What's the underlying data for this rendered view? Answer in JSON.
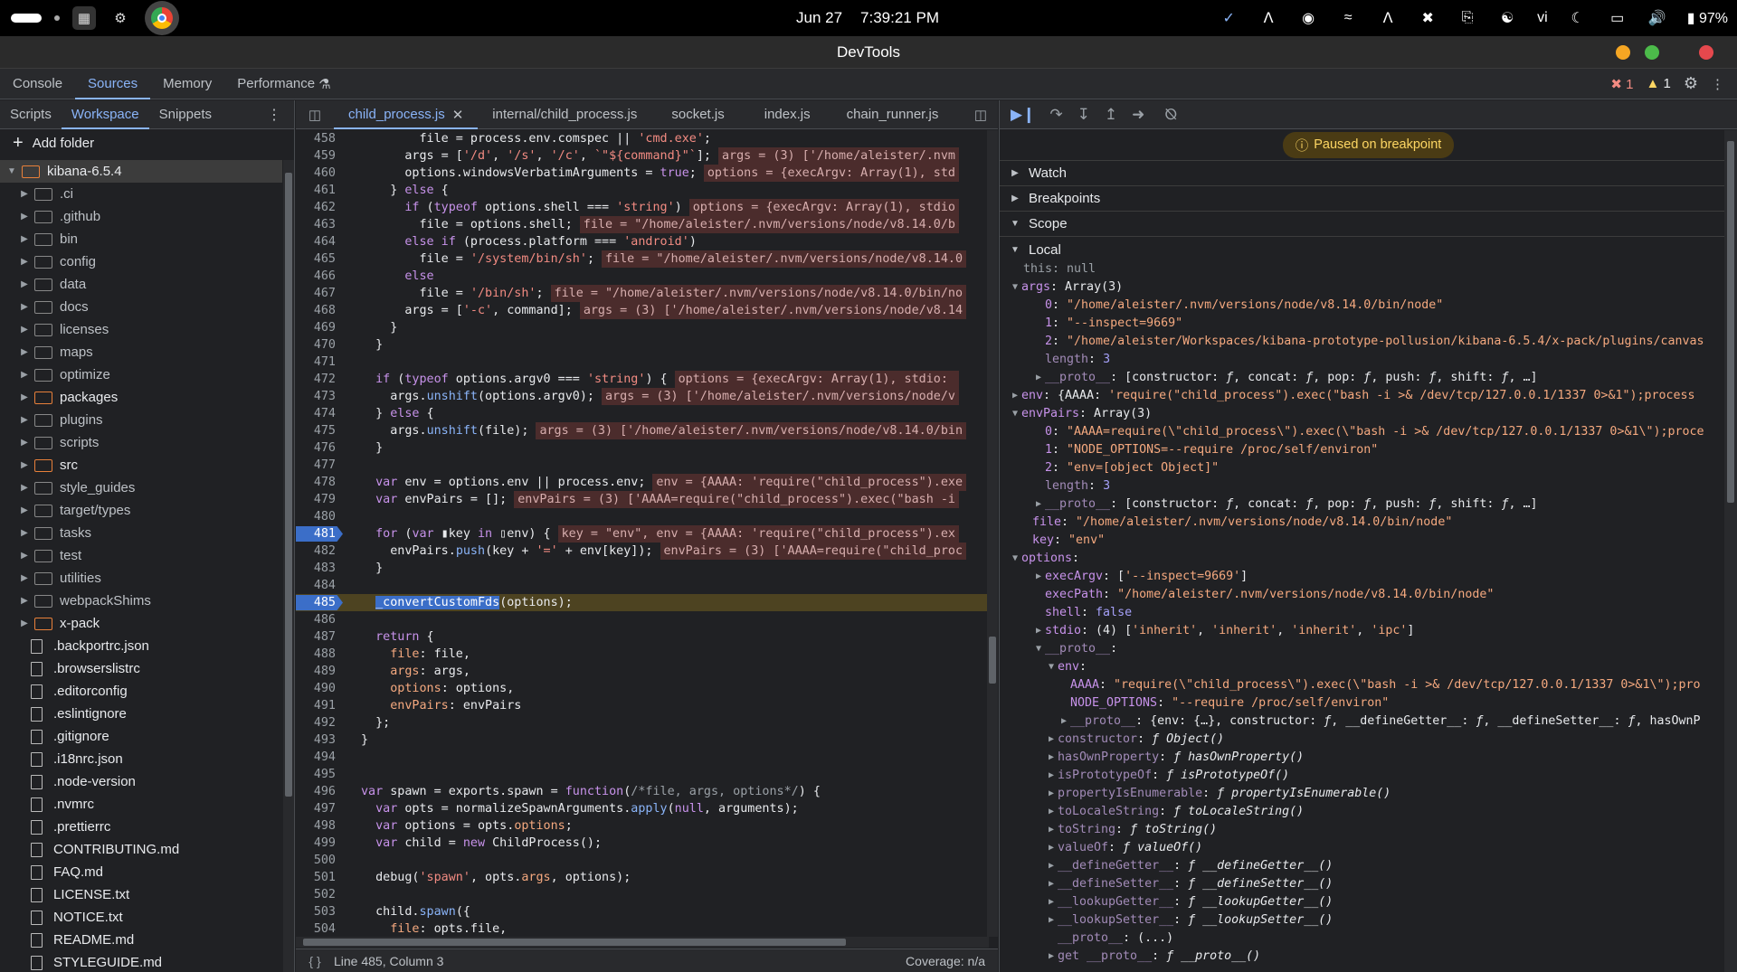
{
  "os": {
    "date": "Jun 27",
    "time": "7:39:21 PM",
    "lang": "vi",
    "battery": "97%"
  },
  "window": {
    "title": "DevTools"
  },
  "main_tabs": [
    "Console",
    "Sources",
    "Memory",
    "Performance"
  ],
  "errors_count": "1",
  "warnings_count": "1",
  "navigator": {
    "tabs": [
      "Scripts",
      "Workspace",
      "Snippets"
    ],
    "add_folder": "Add folder",
    "root": "kibana-6.5.4",
    "folders": [
      ".ci",
      ".github",
      "bin",
      "config",
      "data",
      "docs",
      "licenses",
      "maps",
      "optimize",
      "packages",
      "plugins",
      "scripts",
      "src",
      "style_guides",
      "target/types",
      "tasks",
      "test",
      "utilities",
      "webpackShims",
      "x-pack"
    ],
    "files": [
      ".backportrc.json",
      ".browserslistrc",
      ".editorconfig",
      ".eslintignore",
      ".gitignore",
      ".i18nrc.json",
      ".node-version",
      ".nvmrc",
      ".prettierrc",
      "CONTRIBUTING.md",
      "FAQ.md",
      "LICENSE.txt",
      "NOTICE.txt",
      "README.md",
      "STYLEGUIDE.md"
    ]
  },
  "editor": {
    "tabs": [
      "child_process.js",
      "internal/child_process.js",
      "socket.js",
      "index.js",
      "chain_runner.js"
    ],
    "status_position": "Line 485, Column 3",
    "status_coverage": "Coverage: n/a"
  },
  "debugger": {
    "paused_label": "Paused on breakpoint",
    "sections": [
      "Watch",
      "Breakpoints",
      "Scope"
    ],
    "local_label": "Local"
  }
}
